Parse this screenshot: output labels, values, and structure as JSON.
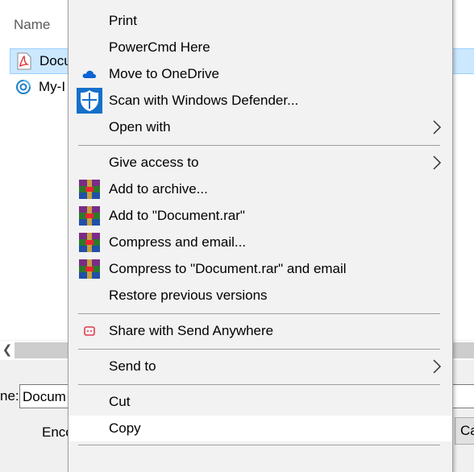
{
  "explorer": {
    "column_name": "Name",
    "files": [
      {
        "name": "Docu",
        "icon": "pdf-icon",
        "selected": true
      },
      {
        "name": "My-I",
        "icon": "app-target-icon",
        "selected": false
      }
    ],
    "file_name_label": "ne:",
    "file_name_value": "Docum",
    "encoding_label": "Enco",
    "cancel_label": "Ca"
  },
  "context_menu": {
    "items": [
      {
        "id": "print",
        "label": "Print",
        "icon": ""
      },
      {
        "id": "powercmd",
        "label": "PowerCmd Here",
        "icon": ""
      },
      {
        "id": "onedrive",
        "label": "Move to OneDrive",
        "icon": "onedrive-cloud-icon"
      },
      {
        "id": "defender",
        "label": "Scan with Windows Defender...",
        "icon": "windows-defender-shield-icon"
      },
      {
        "id": "open-with",
        "label": "Open with",
        "icon": "",
        "submenu": true
      },
      {
        "id": "give-access",
        "label": "Give access to",
        "icon": "",
        "submenu": true
      },
      {
        "id": "add-archive",
        "label": "Add to archive...",
        "icon": "winrar-icon"
      },
      {
        "id": "add-rar",
        "label": "Add to \"Document.rar\"",
        "icon": "winrar-icon"
      },
      {
        "id": "compress-email",
        "label": "Compress and email...",
        "icon": "winrar-icon"
      },
      {
        "id": "compress-rar-email",
        "label": "Compress to \"Document.rar\" and email",
        "icon": "winrar-icon"
      },
      {
        "id": "restore",
        "label": "Restore previous versions",
        "icon": ""
      },
      {
        "id": "send-anywhere",
        "label": "Share with Send Anywhere",
        "icon": "send-anywhere-icon"
      },
      {
        "id": "send-to",
        "label": "Send to",
        "icon": "",
        "submenu": true
      },
      {
        "id": "cut",
        "label": "Cut",
        "icon": ""
      },
      {
        "id": "copy",
        "label": "Copy",
        "icon": "",
        "hovered": true
      }
    ]
  },
  "colors": {
    "menu_bg": "#f2f2f2",
    "hover_bg": "#ffffff",
    "selection": "#cce8ff",
    "separator": "#a0a0a0",
    "pdf_red": "#e0282e",
    "onedrive_blue": "#0a64d2",
    "defender_blue": "#1570c9"
  }
}
